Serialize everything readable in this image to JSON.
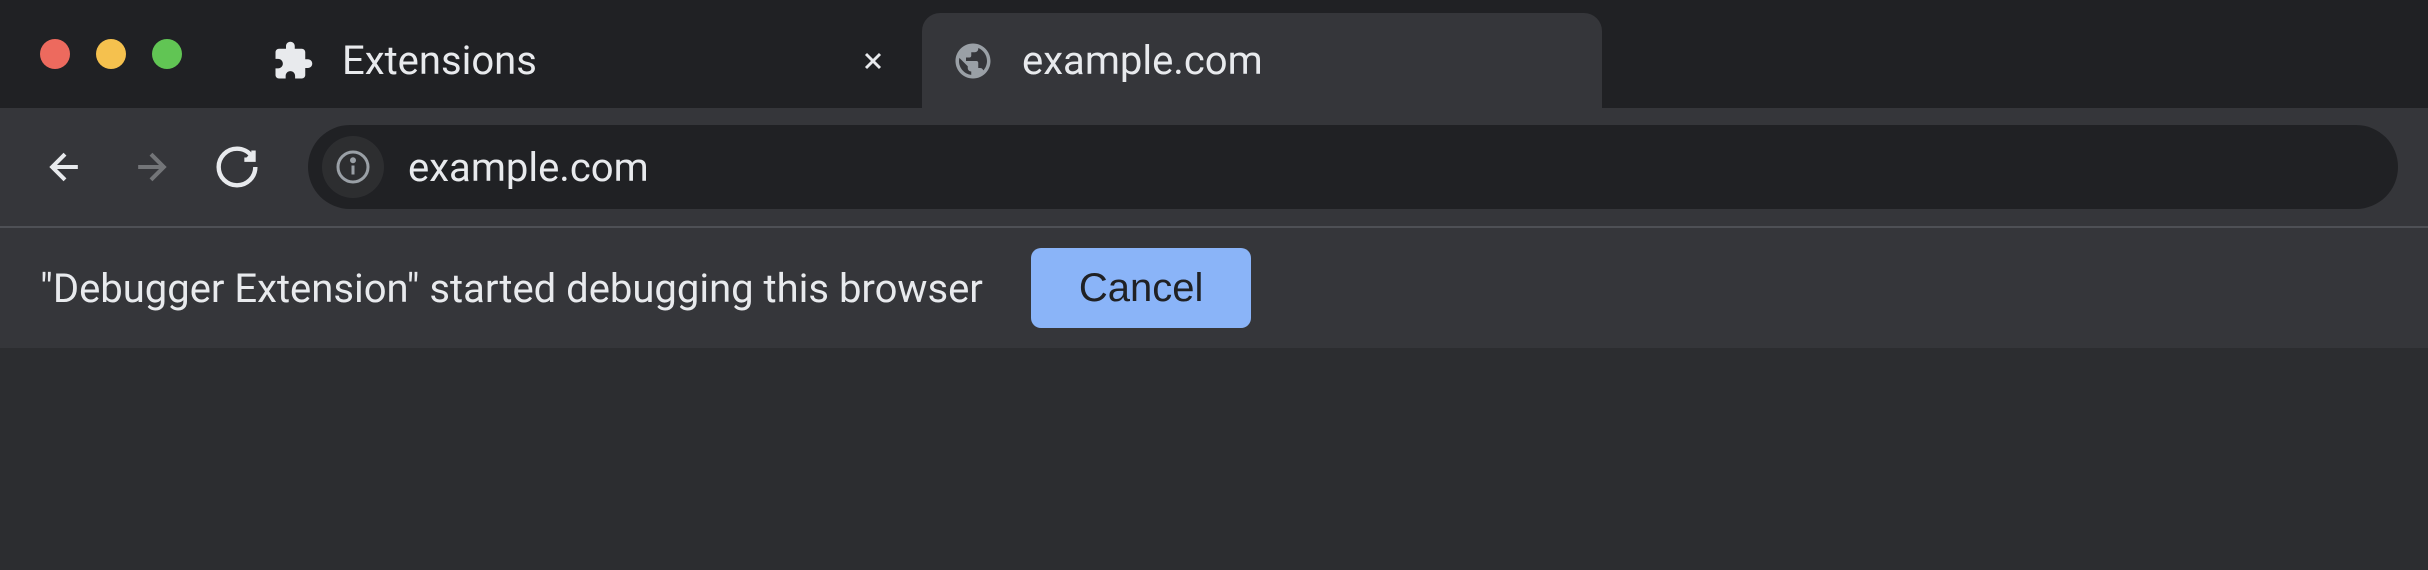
{
  "tabs": [
    {
      "title": "Extensions",
      "icon": "puzzle",
      "active": false
    },
    {
      "title": "example.com",
      "icon": "globe",
      "active": true
    }
  ],
  "toolbar": {
    "url": "example.com"
  },
  "infobar": {
    "message": "\"Debugger Extension\" started debugging this browser",
    "cancel_label": "Cancel"
  }
}
